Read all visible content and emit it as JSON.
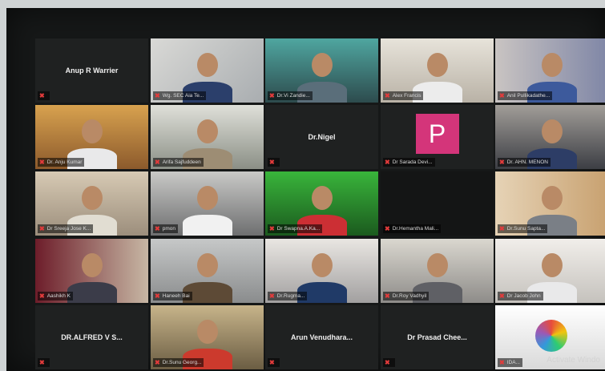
{
  "participants": [
    {
      "name": "Anup R Warrier",
      "bar": ""
    },
    {
      "name": "",
      "bar": "Wg. SEC Aia Te..."
    },
    {
      "name": "",
      "bar": "Dr.Vi Zandie..."
    },
    {
      "name": "",
      "bar": "Alex Francis"
    },
    {
      "name": "",
      "bar": "Anil Pullikadathe..."
    },
    {
      "name": "",
      "bar": "Dr. Anju Kumar"
    },
    {
      "name": "",
      "bar": "Arifa Sajfuddeen"
    },
    {
      "name": "Dr.Nigel",
      "bar": ""
    },
    {
      "name": "",
      "bar": "Dr Sarada Devi...",
      "initial": "P"
    },
    {
      "name": "",
      "bar": "Dr. AHN. MENON"
    },
    {
      "name": "",
      "bar": "Dr Sreeja Jose K..."
    },
    {
      "name": "",
      "bar": "pmon"
    },
    {
      "name": "",
      "bar": "Dr Swapna.A.Ka..."
    },
    {
      "name": "",
      "bar": "Dr.Hemantha Mali..."
    },
    {
      "name": "",
      "bar": "Dr.Sunu Sapta..."
    },
    {
      "name": "",
      "bar": "Aashikh K"
    },
    {
      "name": "",
      "bar": "Haneeh Bai"
    },
    {
      "name": "",
      "bar": "Dr.Rugma..."
    },
    {
      "name": "",
      "bar": "Dr.Roy Vadhyil"
    },
    {
      "name": "",
      "bar": "Dr Jacob John"
    },
    {
      "name": "DR.ALFRED V S...",
      "bar": ""
    },
    {
      "name": "",
      "bar": "Dr.Sunu Georg..."
    },
    {
      "name": "Arun Venudhara...",
      "bar": ""
    },
    {
      "name": "Dr Prasad Chee...",
      "bar": ""
    },
    {
      "name": "",
      "bar": "IDA..."
    }
  ],
  "watermark": "Activate Windo",
  "colors": {
    "mute": "#e23b3b",
    "active_border": "#e9e07a",
    "initial_bg": "#d4357a"
  }
}
